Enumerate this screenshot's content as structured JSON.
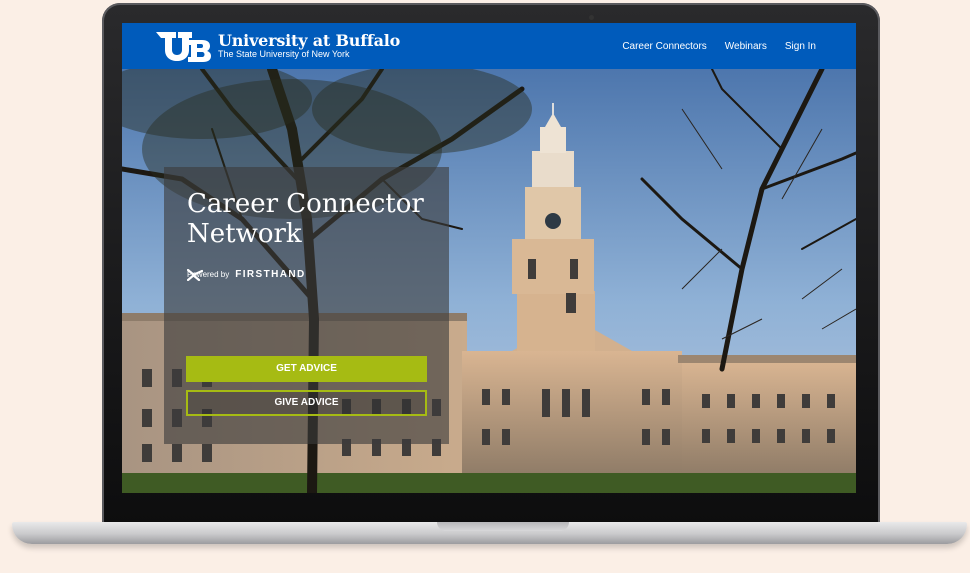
{
  "brand": {
    "title": "University at Buffalo",
    "subtitle": "The State University of New York"
  },
  "nav": {
    "items": [
      "Career Connectors",
      "Webinars",
      "Sign In"
    ]
  },
  "hero": {
    "title_line1": "Career Connector",
    "title_line2": "Network",
    "powered_by": "Powered by",
    "partner": "FIRSTHAND",
    "get_advice": "GET ADVICE",
    "give_advice": "GIVE ADVICE"
  },
  "colors": {
    "header_blue": "#005bbb",
    "accent_green": "#a6bb13",
    "page_background": "#fbefe6"
  },
  "icons": [
    "ub-logo-icon",
    "firsthand-logo-icon",
    "camera-icon"
  ]
}
